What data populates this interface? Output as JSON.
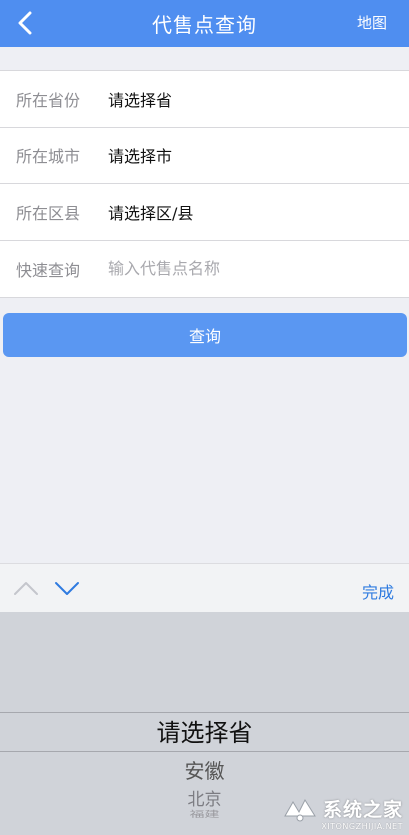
{
  "header": {
    "title": "代售点查询",
    "map_label": "地图",
    "back_icon": "chevron-left-icon",
    "background_color": "#4f8ef0"
  },
  "form": {
    "province": {
      "label": "所在省份",
      "value": "请选择省"
    },
    "city": {
      "label": "所在城市",
      "value": "请选择市"
    },
    "district": {
      "label": "所在区县",
      "value": "请选择区/县"
    },
    "quick_search": {
      "label": "快速查询",
      "placeholder": "输入代售点名称",
      "value": ""
    }
  },
  "query_button": {
    "label": "查询",
    "color": "#5a97f2"
  },
  "picker_toolbar": {
    "prev_icon": "chevron-up-icon",
    "next_icon": "chevron-down-icon",
    "done_label": "完成",
    "done_color": "#2f7be0"
  },
  "picker": {
    "selected": "请选择省",
    "options": [
      "请选择省",
      "安徽",
      "北京",
      "福建"
    ]
  },
  "watermark": {
    "name": "系统之家",
    "url": "XITONGZHIJIA.NET"
  }
}
